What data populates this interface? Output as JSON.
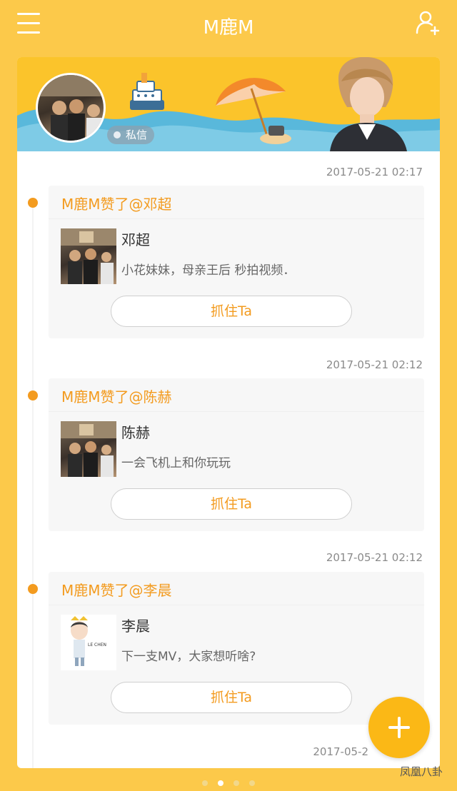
{
  "header": {
    "title": "M鹿M",
    "menu_icon": "hamburger-menu-icon",
    "add_user_icon": "add-user-icon"
  },
  "banner": {
    "dm_label": "私信"
  },
  "feed": [
    {
      "timestamp": "2017-05-21 02:17",
      "headline": "M鹿M赞了@邓超",
      "name": "邓超",
      "text": "小花妹妹，母亲王后 秒拍视频．",
      "button": "抓住Ta"
    },
    {
      "timestamp": "2017-05-21 02:12",
      "headline": "M鹿M赞了@陈赫",
      "name": "陈赫",
      "text": "一会飞机上和你玩玩",
      "button": "抓住Ta"
    },
    {
      "timestamp": "2017-05-21 02:12",
      "headline": "M鹿M赞了@李晨",
      "name": "李晨",
      "text": "下一支MV，大家想听啥?",
      "button": "抓住Ta"
    },
    {
      "timestamp": "2017-05-2"
    }
  ],
  "watermark": "凤凰八卦",
  "colors": {
    "background": "#FCC94A",
    "accent": "#F39B1F",
    "card": "#FFFFFF"
  }
}
